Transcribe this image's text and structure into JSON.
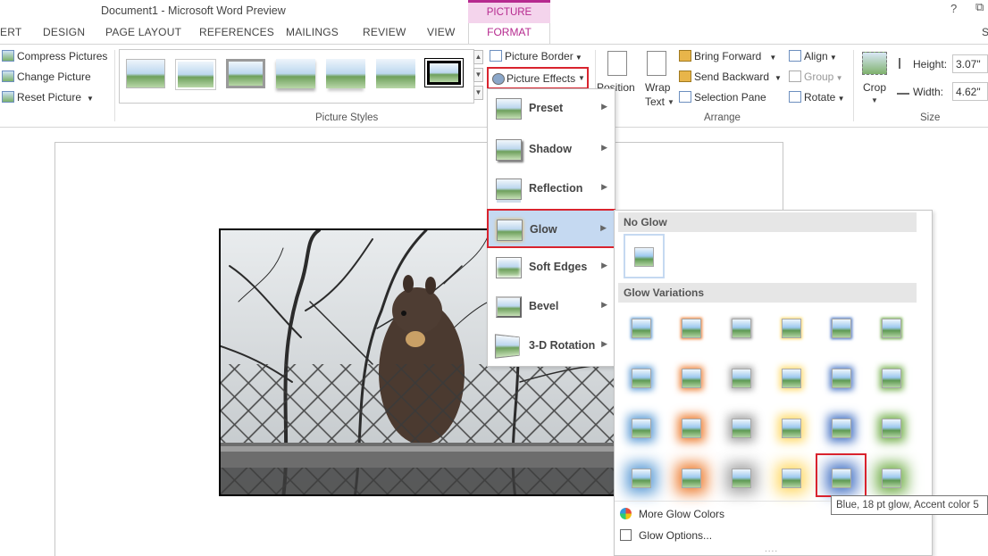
{
  "window": {
    "title": "Document1 - Microsoft Word Preview",
    "contextual_tab_group": "PICTURE TOOLS",
    "help": "?",
    "minimize": "–",
    "restore": "⧉"
  },
  "tabs": [
    {
      "label": "ERT"
    },
    {
      "label": "DESIGN"
    },
    {
      "label": "PAGE LAYOUT"
    },
    {
      "label": "REFERENCES"
    },
    {
      "label": "MAILINGS"
    },
    {
      "label": "REVIEW"
    },
    {
      "label": "VIEW"
    },
    {
      "label": "FORMAT"
    },
    {
      "label": "S"
    }
  ],
  "ribbon": {
    "adjust": {
      "compress": "Compress Pictures",
      "change": "Change Picture",
      "reset": "Reset Picture"
    },
    "picture_styles": {
      "label": "Picture Styles",
      "border": "Picture Border",
      "effects": "Picture Effects"
    },
    "arrange": {
      "label": "Arrange",
      "position": "Position",
      "wrap": "Wrap",
      "wrap2": "Text",
      "bring_forward": "Bring Forward",
      "send_backward": "Send Backward",
      "selection_pane": "Selection Pane",
      "align": "Align",
      "group": "Group",
      "rotate": "Rotate"
    },
    "size": {
      "label": "Size",
      "crop": "Crop",
      "height_label": "Height:",
      "height_value": "3.07\"",
      "width_label": "Width:",
      "width_value": "4.62\""
    }
  },
  "effects_menu": {
    "items": [
      {
        "label": "Preset"
      },
      {
        "label": "Shadow"
      },
      {
        "label": "Reflection"
      },
      {
        "label": "Glow"
      },
      {
        "label": "Soft Edges"
      },
      {
        "label": "Bevel"
      },
      {
        "label": "3-D Rotation"
      }
    ]
  },
  "glow_panel": {
    "no_glow": "No Glow",
    "variations": "Glow Variations",
    "more_colors": "More Glow Colors",
    "options": "Glow Options...",
    "colors": [
      "#5b9bd5",
      "#ed7d31",
      "#a5a5a5",
      "#ffd966",
      "#4472c4",
      "#70ad47"
    ],
    "selected_tooltip": "Blue, 18 pt glow, Accent color 5"
  }
}
